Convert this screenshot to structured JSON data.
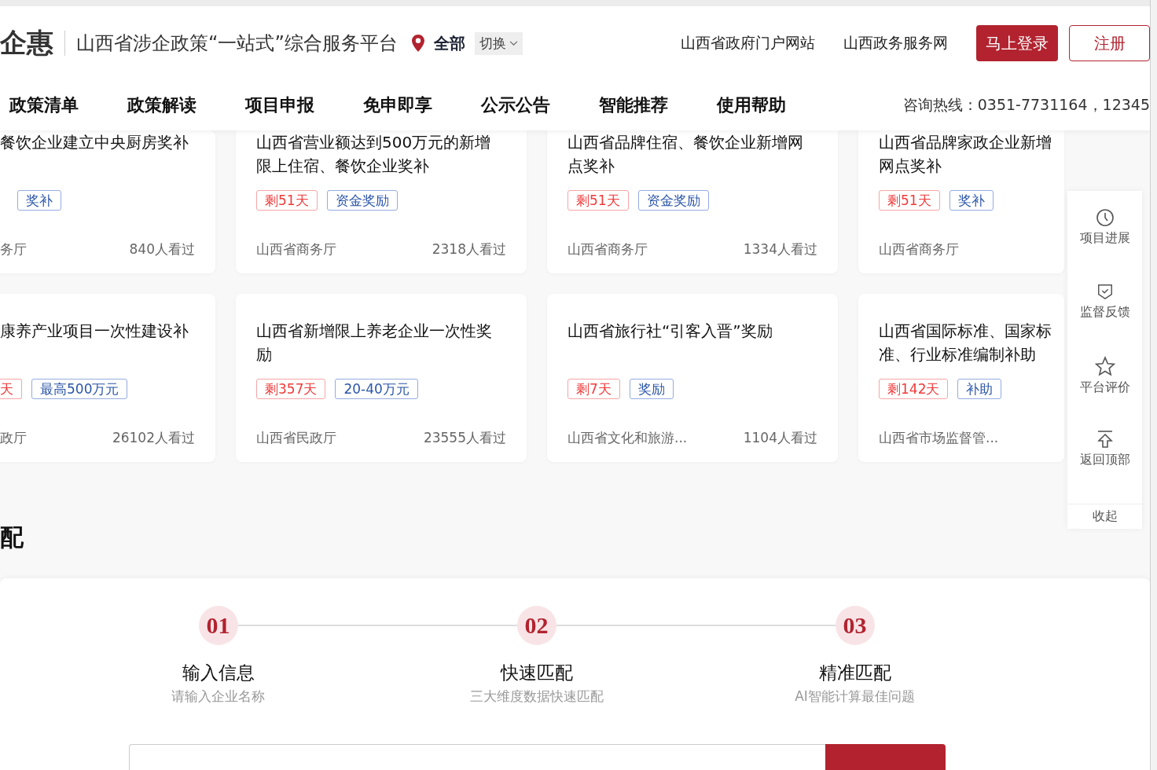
{
  "header": {
    "logo": "企惠",
    "platform_title": "山西省涉企政策“一站式”综合服务平台",
    "region": "全部",
    "switch_label": "切换",
    "links": [
      "山西省政府门户网站",
      "山西政务服务网"
    ],
    "login_button": "马上登录",
    "register_button": "注册"
  },
  "nav": {
    "items": [
      "政策清单",
      "政策解读",
      "项目申报",
      "免申即享",
      "公示公告",
      "智能推荐",
      "使用帮助"
    ],
    "hotline": "咨询热线：0351-7731164，12345"
  },
  "cards": [
    {
      "clipped": true,
      "title": "餐饮企业建立中央厨房奖补",
      "tags": [
        {
          "kind": "type",
          "text": "奖补"
        }
      ],
      "department": "务厅",
      "views": "840人看过"
    },
    {
      "clipped": false,
      "title": "山西省营业额达到500万元的新增限上住宿、餐饮企业奖补",
      "tags": [
        {
          "kind": "days",
          "text": "剩51天"
        },
        {
          "kind": "type",
          "text": "资金奖励"
        }
      ],
      "department": "山西省商务厅",
      "views": "2318人看过"
    },
    {
      "clipped": false,
      "title": "山西省品牌住宿、餐饮企业新增网点奖补",
      "tags": [
        {
          "kind": "days",
          "text": "剩51天"
        },
        {
          "kind": "type",
          "text": "资金奖励"
        }
      ],
      "department": "山西省商务厅",
      "views": "1334人看过"
    },
    {
      "clipped": false,
      "title": "山西省品牌家政企业新增网点奖补",
      "tags": [
        {
          "kind": "days",
          "text": "剩51天"
        },
        {
          "kind": "type",
          "text": "奖补"
        }
      ],
      "department": "山西省商务厅"
    },
    {
      "clipped": true,
      "title": "康养产业项目一次性建设补",
      "tags": [
        {
          "kind": "days",
          "text": "天"
        },
        {
          "kind": "type",
          "text": "最高500万元"
        }
      ],
      "department": "政厅",
      "views": "26102人看过"
    },
    {
      "clipped": false,
      "title": "山西省新增限上养老企业一次性奖励",
      "tags": [
        {
          "kind": "days",
          "text": "剩357天"
        },
        {
          "kind": "type",
          "text": "20-40万元"
        }
      ],
      "department": "山西省民政厅",
      "views": "23555人看过"
    },
    {
      "clipped": false,
      "title": "山西省旅行社“引客入晋”奖励",
      "tags": [
        {
          "kind": "days",
          "text": "剩7天"
        },
        {
          "kind": "type",
          "text": "奖励"
        }
      ],
      "department": "山西省文化和旅游...",
      "views": "1104人看过"
    },
    {
      "clipped": false,
      "title": "山西省国际标准、国家标准、行业标准编制补助",
      "tags": [
        {
          "kind": "days",
          "text": "剩142天"
        },
        {
          "kind": "type",
          "text": "补助"
        }
      ],
      "department": "山西省市场监督管..."
    }
  ],
  "section_heading": "配",
  "steps": [
    {
      "number": "01",
      "title": "输入信息",
      "subtitle": "请输入企业名称"
    },
    {
      "number": "02",
      "title": "快速匹配",
      "subtitle": "三大维度数据快速匹配"
    },
    {
      "number": "03",
      "title": "精准匹配",
      "subtitle": "AI智能计算最佳问题"
    }
  ],
  "float_panel": {
    "items": [
      {
        "label": "项目进展"
      },
      {
        "label": "监督反馈"
      },
      {
        "label": "平台评价"
      },
      {
        "label": "返回顶部"
      }
    ],
    "collapse": "收起"
  }
}
